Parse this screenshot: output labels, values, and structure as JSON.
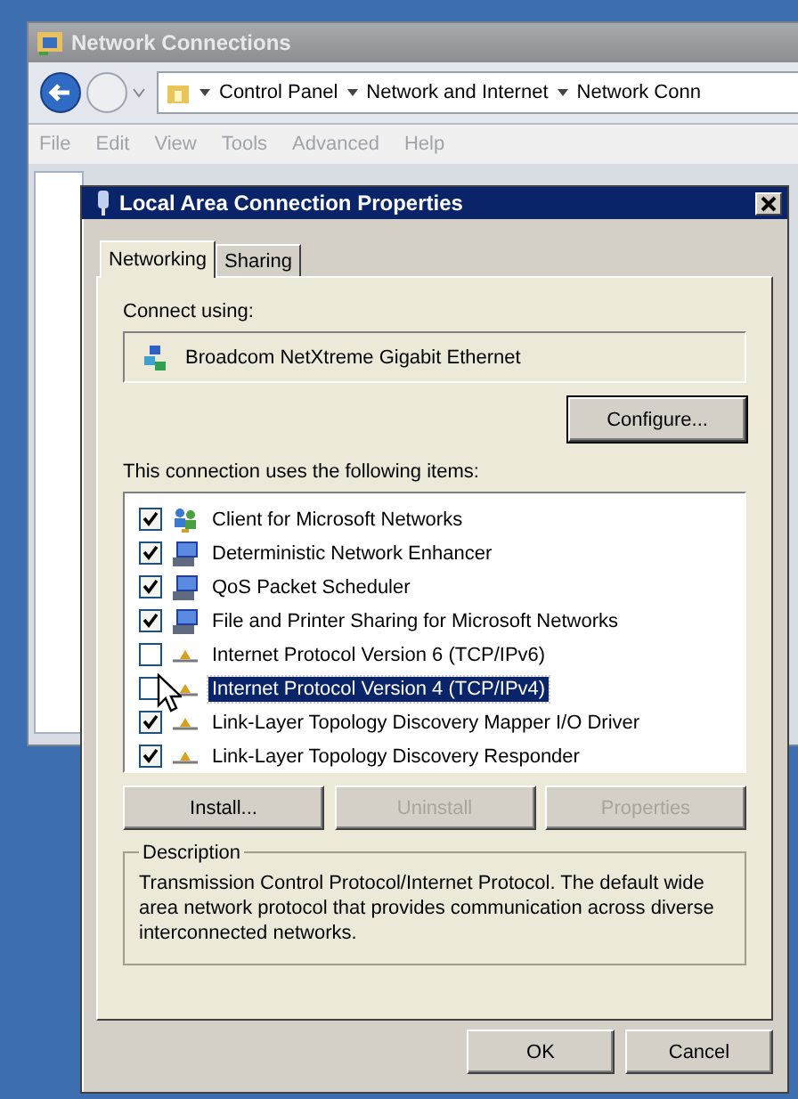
{
  "back_window": {
    "title": "Network Connections",
    "breadcrumb": [
      "Control Panel",
      "Network and Internet",
      "Network Conn"
    ],
    "menu": [
      "File",
      "Edit",
      "View",
      "Tools",
      "Advanced",
      "Help"
    ]
  },
  "dialog": {
    "title": "Local Area Connection Properties",
    "tabs": [
      {
        "label": "Networking",
        "selected": true
      },
      {
        "label": "Sharing",
        "selected": false
      }
    ],
    "connect_using_label": "Connect using:",
    "adapter": "Broadcom NetXtreme Gigabit Ethernet",
    "configure_button": "Configure...",
    "items_label": "This connection uses the following items:",
    "items": [
      {
        "label": "Client for Microsoft Networks",
        "checked": true,
        "selected": false,
        "kind": "client"
      },
      {
        "label": "Deterministic Network Enhancer",
        "checked": true,
        "selected": false,
        "kind": "service"
      },
      {
        "label": "QoS Packet Scheduler",
        "checked": true,
        "selected": false,
        "kind": "service"
      },
      {
        "label": "File and Printer Sharing for Microsoft Networks",
        "checked": true,
        "selected": false,
        "kind": "service"
      },
      {
        "label": "Internet Protocol Version 6 (TCP/IPv6)",
        "checked": false,
        "selected": false,
        "kind": "protocol"
      },
      {
        "label": "Internet Protocol Version 4 (TCP/IPv4)",
        "checked": false,
        "selected": true,
        "kind": "protocol"
      },
      {
        "label": "Link-Layer Topology Discovery Mapper I/O Driver",
        "checked": true,
        "selected": false,
        "kind": "protocol"
      },
      {
        "label": "Link-Layer Topology Discovery Responder",
        "checked": true,
        "selected": false,
        "kind": "protocol"
      }
    ],
    "item_buttons": [
      {
        "label": "Install...",
        "disabled": false
      },
      {
        "label": "Uninstall",
        "disabled": true
      },
      {
        "label": "Properties",
        "disabled": true
      }
    ],
    "description": {
      "legend": "Description",
      "text": "Transmission Control Protocol/Internet Protocol. The default wide area network protocol that provides communication across diverse interconnected networks."
    },
    "buttons": [
      "OK",
      "Cancel"
    ]
  }
}
